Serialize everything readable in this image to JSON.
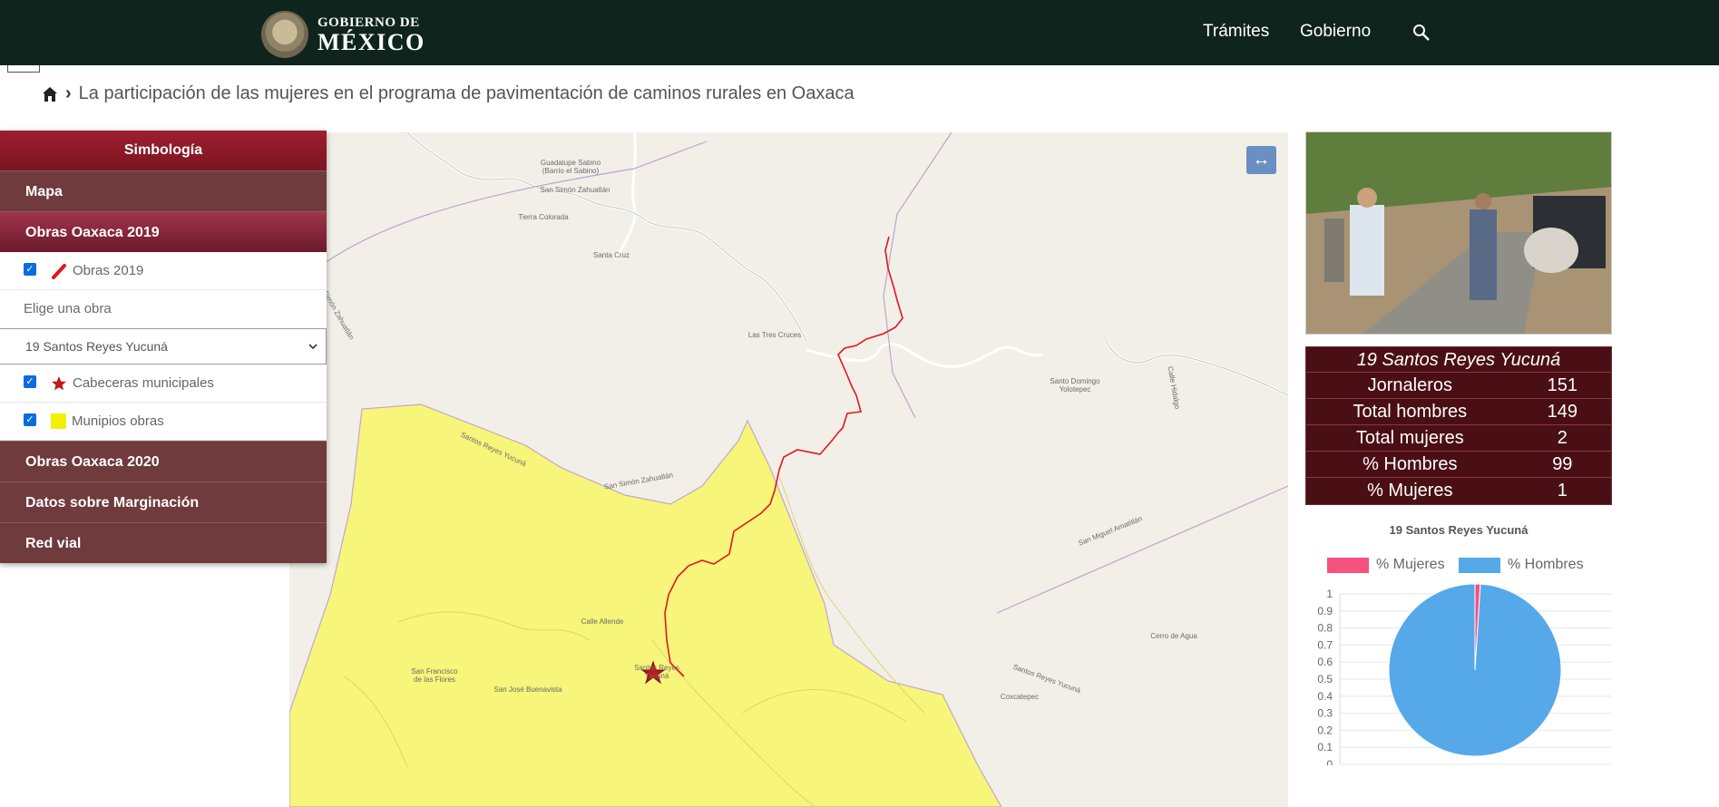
{
  "header": {
    "logo_line1": "GOBIERNO DE",
    "logo_line2": "MÉXICO",
    "nav": [
      "Trámites",
      "Gobierno"
    ]
  },
  "breadcrumb": {
    "title": "La participación de las mujeres en el programa de pavimentación de caminos rurales en Oaxaca"
  },
  "sidebar": {
    "header": "Simbología",
    "mapa": "Mapa",
    "obras_2019": "Obras Oaxaca 2019",
    "layer_obras_2019": "Obras 2019",
    "choose_label": "Elige una obra",
    "select_value": "19 Santos Reyes Yucuná",
    "layer_cabeceras": "Cabeceras municipales",
    "layer_municipios": "Munipios obras",
    "obras_2020": "Obras Oaxaca 2020",
    "marginacion": "Datos sobre Marginación",
    "red_vial": "Red vial"
  },
  "map": {
    "labels": [
      "Guadalupe Sabino\n(Barrio el Sabino)",
      "San Simón Zahuatlán",
      "Tierra Colorada",
      "Santa Cruz",
      "Las Tres Cruces",
      "Santo Domingo\nYolotepec",
      "San Simón Zahuatlán",
      "Santos Reyes Yucuná",
      "San Miguel Amatitlán",
      "Cerro de Agua",
      "Calle Allende",
      "San Francisco\nde las Flores",
      "San José Buenavista",
      "Santos Reyes\nYucuná",
      "Coxcatepec",
      "Santos Reyes Yucuná",
      "San Simón Zahuatlán",
      "Calle Hidalgo"
    ],
    "colors": {
      "municipio": "#f7f570",
      "obra": "#e3161b",
      "cabecera": "#c2171c"
    }
  },
  "stats": {
    "title": "19 Santos Reyes Yucuná",
    "rows": [
      {
        "label": "Jornaleros",
        "value": "151"
      },
      {
        "label": "Total hombres",
        "value": "149"
      },
      {
        "label": "Total mujeres",
        "value": "2"
      },
      {
        "label": "% Hombres",
        "value": "99"
      },
      {
        "label": "% Mujeres",
        "value": "1"
      }
    ]
  },
  "chart_data": {
    "type": "pie",
    "title": "19 Santos Reyes Yucuná",
    "series": [
      {
        "name": "% Mujeres",
        "value": 1,
        "color": "#f4527f"
      },
      {
        "name": "% Hombres",
        "value": 99,
        "color": "#56a9e8"
      }
    ],
    "yticks": [
      "1",
      "0.9",
      "0.8",
      "0.7",
      "0.6",
      "0.5",
      "0.4",
      "0.3",
      "0.2",
      "0.1",
      "0"
    ],
    "legend_position": "top"
  }
}
